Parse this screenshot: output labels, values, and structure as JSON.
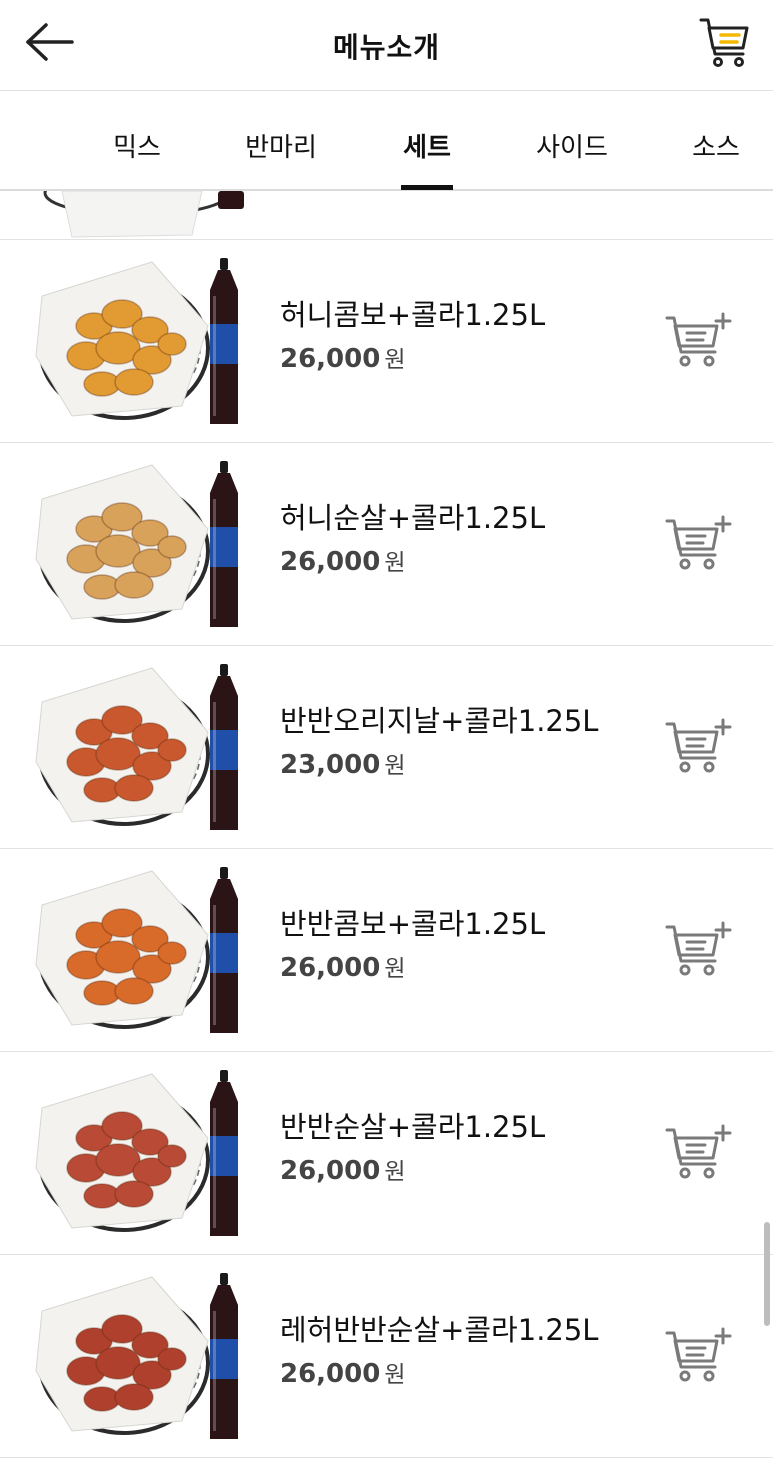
{
  "header": {
    "title": "메뉴소개",
    "back_icon": "back-arrow-icon",
    "cart_icon": "cart-icon",
    "accent": "#F5B800"
  },
  "tabs": {
    "items": [
      {
        "label": "믹스"
      },
      {
        "label": "반마리"
      },
      {
        "label": "세트"
      },
      {
        "label": "사이드"
      },
      {
        "label": "소스"
      }
    ],
    "active": "세트"
  },
  "items": [
    {
      "name": "허니콤보+콜라1.25L",
      "price": "26,000",
      "unit": "원",
      "chicken_color": "#E29A32"
    },
    {
      "name": "허니순살+콜라1.25L",
      "price": "26,000",
      "unit": "원",
      "chicken_color": "#D8A25A"
    },
    {
      "name": "반반오리지날+콜라1.25L",
      "price": "23,000",
      "unit": "원",
      "chicken_color": "#C9582E"
    },
    {
      "name": "반반콤보+콜라1.25L",
      "price": "26,000",
      "unit": "원",
      "chicken_color": "#D86A2A"
    },
    {
      "name": "반반순살+콜라1.25L",
      "price": "26,000",
      "unit": "원",
      "chicken_color": "#B84A36"
    },
    {
      "name": "레허반반순살+콜라1.25L",
      "price": "26,000",
      "unit": "원",
      "chicken_color": "#B0402E"
    }
  ],
  "add_cart_icon": "add-to-cart-icon"
}
